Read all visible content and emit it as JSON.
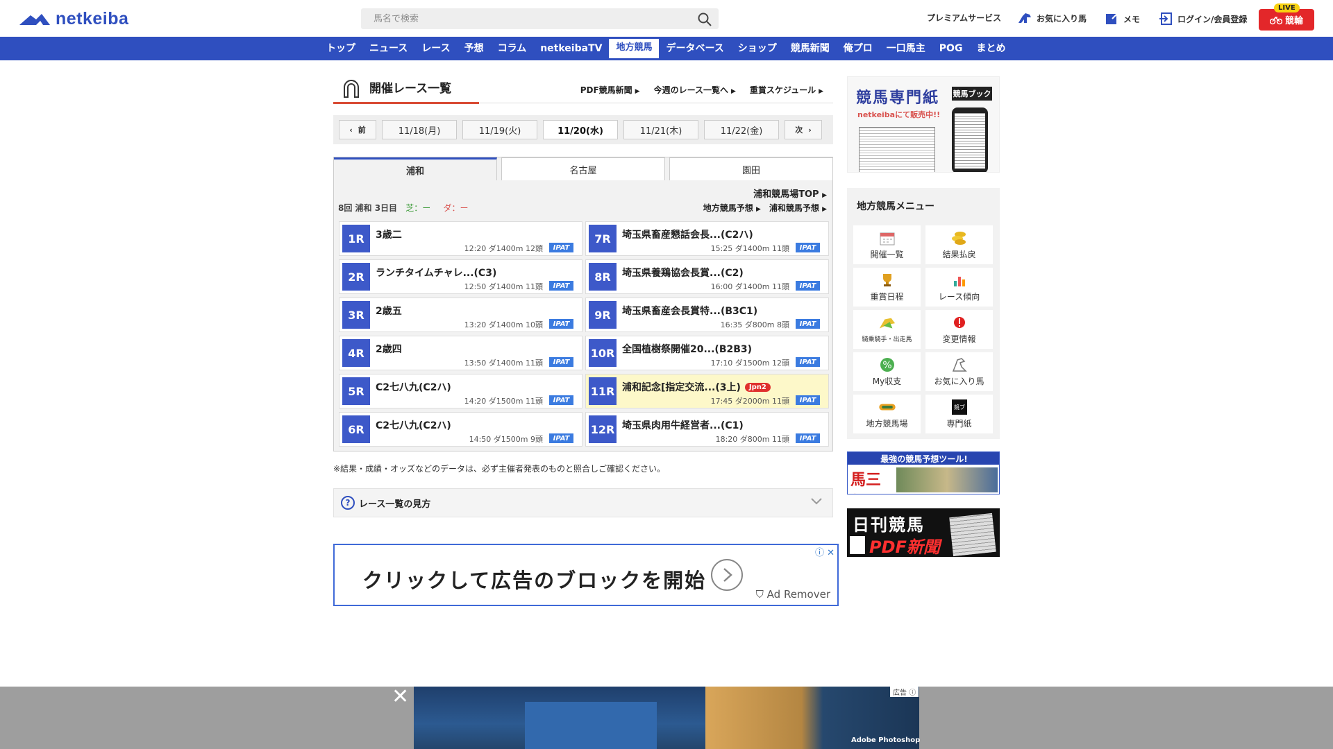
{
  "header": {
    "logo": "netkeiba",
    "search_placeholder": "馬名で検索",
    "nav": [
      {
        "label": "プレミアムサービス",
        "icon": "none"
      },
      {
        "label": "お気に入り馬",
        "icon": "horse-icon"
      },
      {
        "label": "メモ",
        "icon": "memo-icon"
      },
      {
        "label": "ログイン/会員登録",
        "icon": "login-icon"
      }
    ],
    "live_badge": "LIVE",
    "live_label": "競輪"
  },
  "gnav": [
    "トップ",
    "ニュース",
    "レース",
    "予想",
    "コラム",
    "netkeibaTV",
    "地方競馬",
    "データベース",
    "ショップ",
    "競馬新聞",
    "俺プロ",
    "一口馬主",
    "POG",
    "まとめ"
  ],
  "gnav_active": "地方競馬",
  "main": {
    "title": "開催レース一覧",
    "links": [
      "PDF競馬新聞",
      "今週のレース一覧へ",
      "重賞スケジュール"
    ],
    "prev_label": "前",
    "next_label": "次",
    "dates": [
      "11/18(月)",
      "11/19(火)",
      "11/20(水)",
      "11/21(木)",
      "11/22(金)"
    ],
    "selected_date": "11/20(水)",
    "tracks": [
      "浦和",
      "名古屋",
      "園田"
    ],
    "active_track": "浦和",
    "track_top_link": "浦和競馬場TOP",
    "meeting": "8回 浦和 3日目",
    "turf": "芝：ー",
    "dirt": "ダ：ー",
    "meta_links": [
      "地方競馬予想",
      "浦和競馬予想"
    ],
    "races": [
      {
        "num": "1R",
        "name": "3歳二",
        "info": "12:20 ダ1400m 12頭",
        "ipat": "IPAT"
      },
      {
        "num": "7R",
        "name": "埼玉県畜産懇話会長...(C2ハ)",
        "info": "15:25 ダ1400m 11頭",
        "ipat": "IPAT"
      },
      {
        "num": "2R",
        "name": "ランチタイムチャレ...(C3)",
        "info": "12:50 ダ1400m 11頭",
        "ipat": "IPAT"
      },
      {
        "num": "8R",
        "name": "埼玉県養鶏協会長賞...(C2)",
        "info": "16:00 ダ1400m 11頭",
        "ipat": "IPAT"
      },
      {
        "num": "3R",
        "name": "2歳五",
        "info": "13:20 ダ1400m 10頭",
        "ipat": "IPAT"
      },
      {
        "num": "9R",
        "name": "埼玉県畜産会長賞特...(B3C1)",
        "info": "16:35 ダ800m 8頭",
        "ipat": "IPAT"
      },
      {
        "num": "4R",
        "name": "2歳四",
        "info": "13:50 ダ1400m 11頭",
        "ipat": "IPAT"
      },
      {
        "num": "10R",
        "name": "全国植樹祭開催20...(B2B3)",
        "info": "17:10 ダ1500m 12頭",
        "ipat": "IPAT"
      },
      {
        "num": "5R",
        "name": "C2七八九(C2ハ)",
        "info": "14:20 ダ1500m 11頭",
        "ipat": "IPAT"
      },
      {
        "num": "11R",
        "name": "浦和記念[指定交流...(3上)",
        "grade": "Jpn2",
        "info": "17:45 ダ2000m 11頭",
        "ipat": "IPAT",
        "highlight": true
      },
      {
        "num": "6R",
        "name": "C2七八九(C2ハ)",
        "info": "14:50 ダ1500m 9頭",
        "ipat": "IPAT"
      },
      {
        "num": "12R",
        "name": "埼玉県肉用牛経営者...(C1)",
        "info": "18:20 ダ800m 11頭",
        "ipat": "IPAT"
      }
    ],
    "note": "※結果・成績・オッズなどのデータは、必ず主催者発表のものと照合しご確認ください。",
    "howto": "レース一覧の見方",
    "ad_text": "クリックして広告のブロックを開始",
    "ad_brand": "Ad Remover"
  },
  "sidebar": {
    "banner1_title": "競馬専門紙",
    "banner1_tag": "競馬ブック",
    "banner1_sub": "netkeibaにて販売中!!",
    "menu_title": "地方競馬メニュー",
    "menu": [
      {
        "label": "開催一覧",
        "icon": "calendar-icon"
      },
      {
        "label": "結果払戻",
        "icon": "coins-icon"
      },
      {
        "label": "重賞日程",
        "icon": "trophy-icon"
      },
      {
        "label": "レース傾向",
        "icon": "bar-chart-icon"
      },
      {
        "label": "騎乗騎手・出走馬",
        "icon": "jockey-icon"
      },
      {
        "label": "変更情報",
        "icon": "alert-icon"
      },
      {
        "label": "My収支",
        "icon": "percent-icon"
      },
      {
        "label": "お気に入り馬",
        "icon": "horse-icon"
      },
      {
        "label": "地方競馬場",
        "icon": "track-icon"
      },
      {
        "label": "専門紙",
        "icon": "newspaper-icon"
      }
    ],
    "banner2_top": "最強の競馬予想ツール!",
    "banner2_logo": "馬三郎",
    "banner3_a": "日刊競馬",
    "banner3_b": "PDF新聞"
  },
  "bottom_ad": {
    "label": "広告",
    "brand": "Adobe Photoshop"
  },
  "colors": {
    "brand": "#2f4fbf",
    "race_number": "#3d59c9",
    "ipat": "#3b7be0",
    "grade": "#e0302d",
    "highlight_row": "#fdf8c9"
  }
}
